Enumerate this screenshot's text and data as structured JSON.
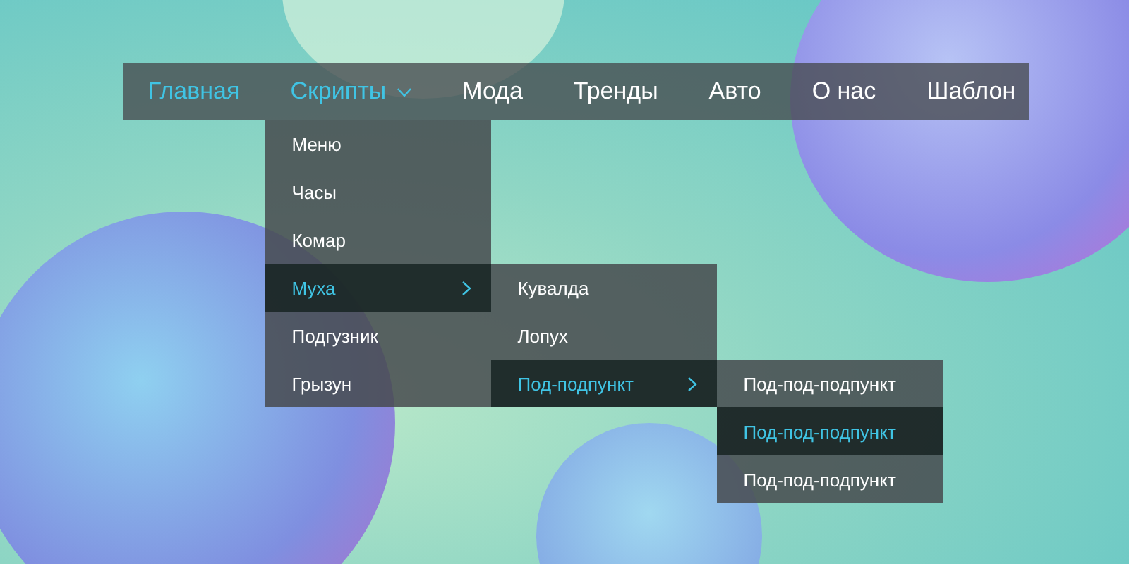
{
  "nav": {
    "items": [
      {
        "label": "Главная",
        "selected": true
      },
      {
        "label": "Скрипты",
        "selected": true,
        "expanded": true,
        "children": [
          {
            "label": "Меню",
            "selected": false
          },
          {
            "label": "Часы",
            "selected": false
          },
          {
            "label": "Комар",
            "selected": false
          },
          {
            "label": "Муха",
            "selected": true,
            "expanded": true,
            "children": [
              {
                "label": "Кувалда",
                "selected": false
              },
              {
                "label": "Лопух",
                "selected": false
              },
              {
                "label": "Под-подпункт",
                "selected": true,
                "expanded": true,
                "children": [
                  {
                    "label": "Под-под-подпункт",
                    "selected": false
                  },
                  {
                    "label": "Под-под-подпункт",
                    "selected": true
                  },
                  {
                    "label": "Под-под-подпункт",
                    "selected": false
                  }
                ]
              }
            ]
          },
          {
            "label": "Подгузник",
            "selected": false
          },
          {
            "label": "Грызун",
            "selected": false
          }
        ]
      },
      {
        "label": "Мода",
        "selected": false
      },
      {
        "label": "Тренды",
        "selected": false
      },
      {
        "label": "Авто",
        "selected": false
      },
      {
        "label": "О нас",
        "selected": false
      },
      {
        "label": "Шаблон",
        "selected": false
      }
    ]
  }
}
